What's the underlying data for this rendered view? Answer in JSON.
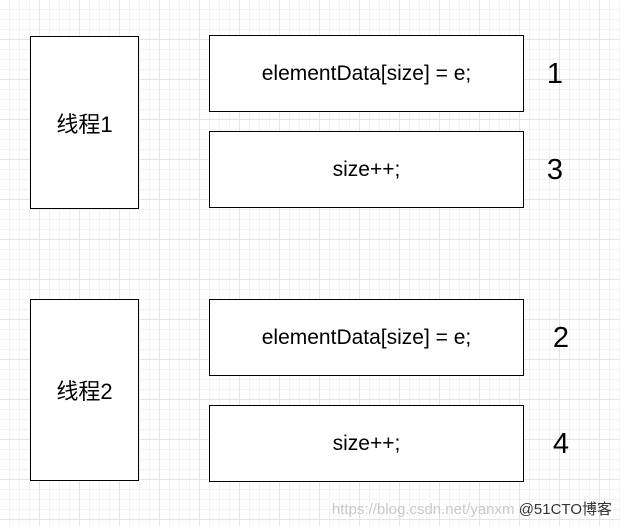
{
  "threads": [
    {
      "label": "线程1",
      "statements": [
        {
          "code": "elementData[size] = e;",
          "order": "1"
        },
        {
          "code": "size++;",
          "order": "3"
        }
      ]
    },
    {
      "label": "线程2",
      "statements": [
        {
          "code": "elementData[size] = e;",
          "order": "2"
        },
        {
          "code": "size++;",
          "order": "4"
        }
      ]
    }
  ],
  "watermark": {
    "faint": "https://blog.csdn.net/yanxm",
    "brand": "@51CTO博客"
  }
}
